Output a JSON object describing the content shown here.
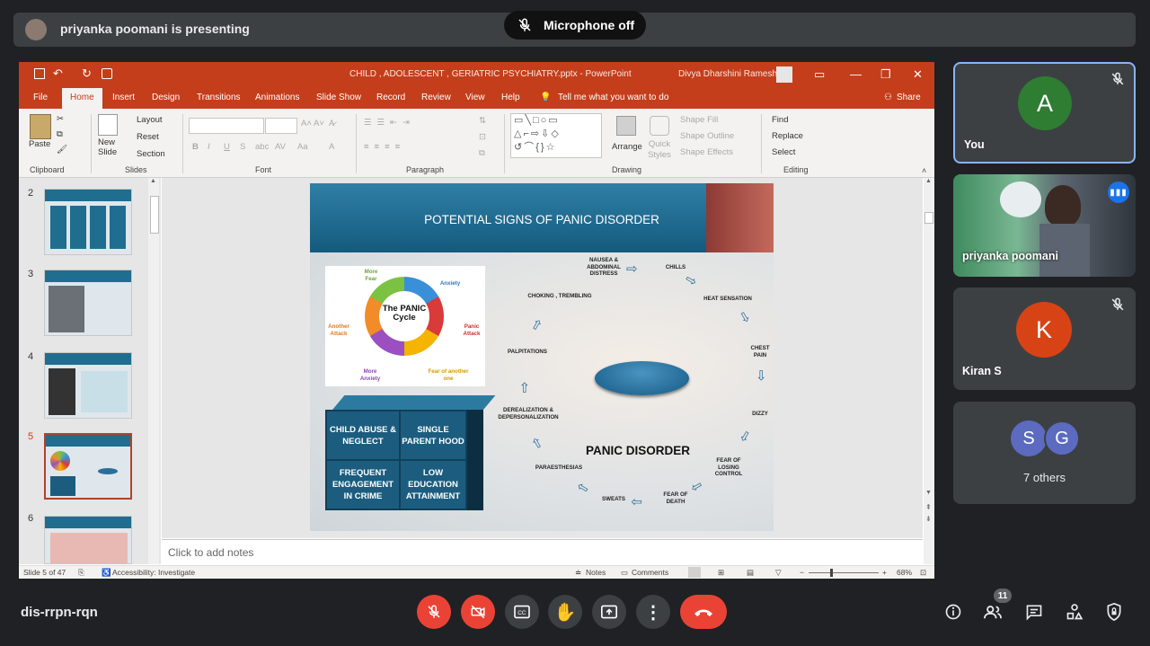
{
  "presenter": {
    "text": "priyanka poomani is presenting"
  },
  "mic_toast": {
    "text": "Microphone off"
  },
  "powerpoint": {
    "doc_title": "CHILD , ADOLESCENT , GERIATRIC PSYCHIATRY.pptx  -  PowerPoint",
    "user_name": "Divya Dharshini Ramesh",
    "tabs": [
      "File",
      "Home",
      "Insert",
      "Design",
      "Transitions",
      "Animations",
      "Slide Show",
      "Record",
      "Review",
      "View",
      "Help"
    ],
    "tell_me": "Tell me what you want to do",
    "share": "Share",
    "ribbon": {
      "clipboard": {
        "paste": "Paste",
        "label": "Clipboard"
      },
      "slides": {
        "new_slide": "New Slide",
        "layout": "Layout",
        "reset": "Reset",
        "section": "Section",
        "label": "Slides"
      },
      "font": {
        "label": "Font"
      },
      "paragraph": {
        "label": "Paragraph"
      },
      "drawing": {
        "arrange": "Arrange",
        "quick_styles": "Quick Styles",
        "shape_fill": "Shape Fill",
        "shape_outline": "Shape Outline",
        "shape_effects": "Shape Effects",
        "label": "Drawing"
      },
      "editing": {
        "find": "Find",
        "replace": "Replace",
        "select": "Select",
        "label": "Editing"
      }
    },
    "thumbnail_numbers": [
      "2",
      "3",
      "4",
      "5",
      "6"
    ],
    "slide": {
      "title": "POTENTIAL SIGNS OF PANIC DISORDER",
      "cycle": {
        "center": "The PANIC Cycle",
        "labels": [
          "More Fear",
          "Anxiety",
          "Panic Attack",
          "Fear of another one",
          "More Anxiety",
          "Another Attack"
        ]
      },
      "boxes": [
        "CHILD ABUSE & NEGLECT",
        "SINGLE PARENT HOOD",
        "FREQUENT ENGAGEMENT IN CRIME",
        "LOW EDUCATION ATTAINMENT"
      ],
      "symptoms": {
        "nausea": "NAUSEA & ABDOMINAL DISTRESS",
        "chills": "CHILLS",
        "heat": "HEAT SENSATION",
        "chest": "CHEST PAIN",
        "dizzy": "DIZZY",
        "losing_control": "FEAR OF LOSING CONTROL",
        "death": "FEAR OF DEATH",
        "sweats": "SWEATS",
        "paraesthesias": "PARAESTHESIAS",
        "derealization": "DEREALIZATION & DEPERSONALIZATION",
        "palpitations": "PALPITATIONS",
        "choking": "CHOKING , TREMBLING"
      },
      "center_label": "PANIC DISORDER"
    },
    "notes_placeholder": "Click to add notes",
    "status": {
      "slide_of": "Slide 5 of 47",
      "accessibility": "Accessibility: Investigate",
      "notes": "Notes",
      "comments": "Comments",
      "zoom": "68%"
    }
  },
  "participants": [
    {
      "name": "You",
      "initial": "A",
      "color": "#2e7d32"
    },
    {
      "name": "priyanka poomani"
    },
    {
      "name": "Kiran S",
      "initial": "K",
      "color": "#d84315"
    },
    {
      "name": "7 others",
      "initials": [
        "S",
        "G"
      ],
      "color": "#5c6bc0"
    }
  ],
  "meeting": {
    "code": "dis-rrpn-rqn",
    "participant_count": "11"
  }
}
